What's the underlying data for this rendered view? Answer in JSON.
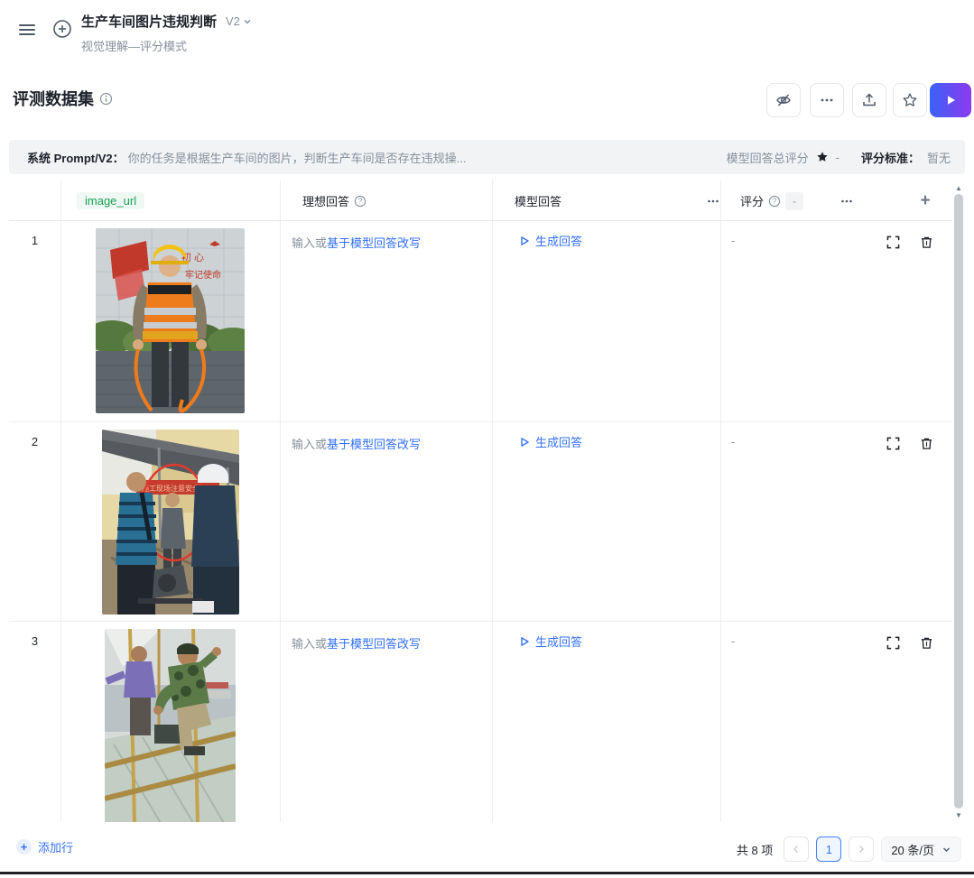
{
  "app": {
    "title": "生产车间图片违规判断",
    "version": "V2",
    "subtitle": "视觉理解—评分模式"
  },
  "dataset": {
    "title": "评测数据集"
  },
  "prompt_bar": {
    "label": "系统 Prompt/V2：",
    "content": "你的任务是根据生产车间的图片，判断生产车间是否存在违规操...",
    "total_score_label": "模型回答总评分",
    "total_score_value": "-",
    "criteria_label": "评分标准：",
    "criteria_value": "暂无"
  },
  "table": {
    "headers": {
      "image": "image_url",
      "ideal": "理想回答",
      "model": "模型回答",
      "score": "评分",
      "score_badge": "-",
      "add_column": "+"
    },
    "rows": [
      {
        "index": "1",
        "image_desc": "戴黄色安全帽、穿橙色反光背心的工人手持橙色绳索，站在红旗标语墙与绿植前",
        "ideal_prefix": "输入或",
        "ideal_link": "基于模型回答改写",
        "generate_label": "生成回答",
        "score": "-"
      },
      {
        "index": "2",
        "image_desc": "车间棚下多名工人，中间一名未戴安全帽的工人被红色圆圈标注",
        "ideal_prefix": "输入或",
        "ideal_link": "基于模型回答改写",
        "generate_label": "生成回答",
        "score": "-"
      },
      {
        "index": "3",
        "image_desc": "两名工人在高处竹制脚手架上作业，背景为城市与码头",
        "ideal_prefix": "输入或",
        "ideal_link": "基于模型回答改写",
        "generate_label": "生成回答",
        "score": "-"
      }
    ]
  },
  "footer": {
    "add_row_label": "添加行",
    "total_label": "共 8 项",
    "current_page": "1",
    "page_size_label": "20 条/页"
  },
  "icons": {
    "header": [
      "menu-icon",
      "circle-plus-icon",
      "chevron-down-icon"
    ],
    "toolbar": [
      "eye-off-icon",
      "more-icon",
      "upload-icon",
      "star-icon",
      "play-icon"
    ],
    "prompt_bar": [
      "star-filled-icon"
    ],
    "table": [
      "help-icon",
      "more-icon",
      "plus-icon",
      "play-outline-icon",
      "expand-icon",
      "trash-icon",
      "scroll-up-icon",
      "scroll-down-icon"
    ],
    "footer": [
      "plus-icon",
      "chevron-left-icon",
      "chevron-right-icon",
      "chevron-down-icon"
    ]
  },
  "colors": {
    "accent_blue": "#3370ff",
    "link_blue": "#3370ff",
    "run_gradient_start": "#3b62f6",
    "run_gradient_end": "#8d3af0",
    "green_column": "#18a058",
    "muted_gray": "#86909c",
    "border_gray": "#e5e6eb",
    "prompt_bg": "#f2f3f5"
  }
}
